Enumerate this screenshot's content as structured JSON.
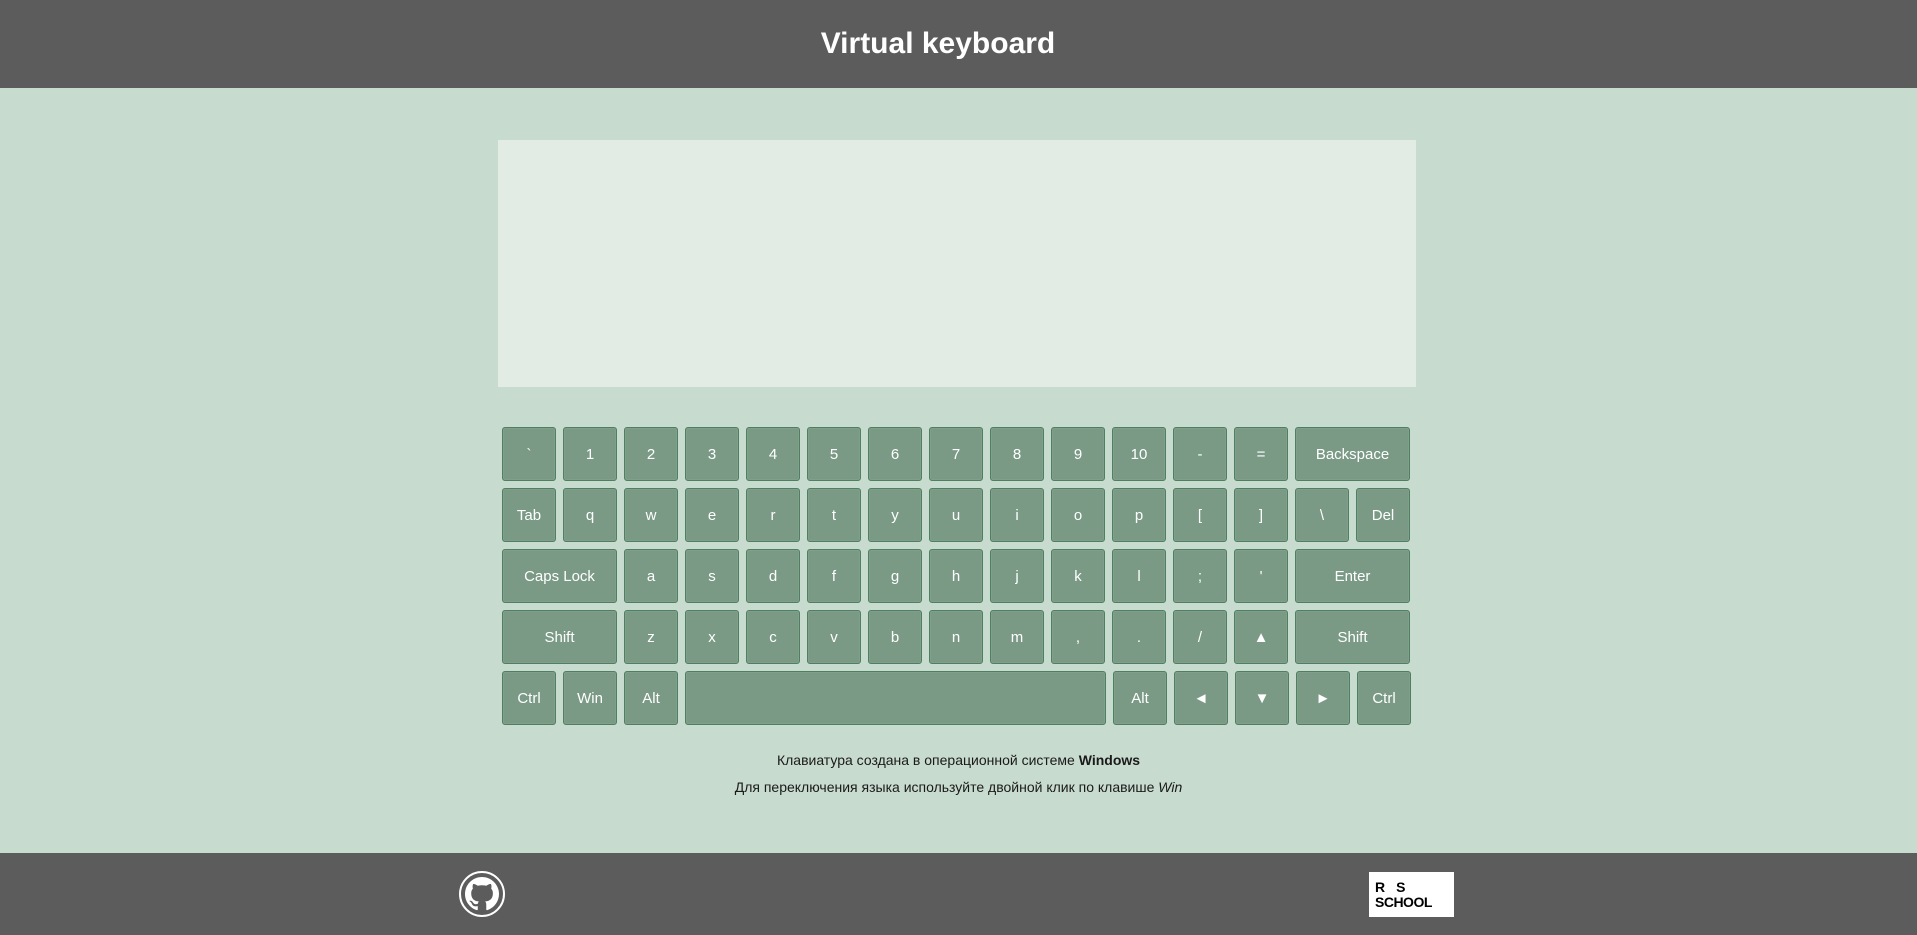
{
  "header": {
    "title": "Virtual keyboard"
  },
  "textarea": {
    "value": ""
  },
  "keyboard": {
    "rows": [
      [
        {
          "label": "`",
          "name": "key-backquote"
        },
        {
          "label": "1",
          "name": "key-1"
        },
        {
          "label": "2",
          "name": "key-2"
        },
        {
          "label": "3",
          "name": "key-3"
        },
        {
          "label": "4",
          "name": "key-4"
        },
        {
          "label": "5",
          "name": "key-5"
        },
        {
          "label": "6",
          "name": "key-6"
        },
        {
          "label": "7",
          "name": "key-7"
        },
        {
          "label": "8",
          "name": "key-8"
        },
        {
          "label": "9",
          "name": "key-9"
        },
        {
          "label": "10",
          "name": "key-10"
        },
        {
          "label": "-",
          "name": "key-minus"
        },
        {
          "label": "=",
          "name": "key-equal"
        },
        {
          "label": "Backspace",
          "name": "key-backspace",
          "wide": true
        }
      ],
      [
        {
          "label": "Tab",
          "name": "key-tab"
        },
        {
          "label": "q",
          "name": "key-q"
        },
        {
          "label": "w",
          "name": "key-w"
        },
        {
          "label": "e",
          "name": "key-e"
        },
        {
          "label": "r",
          "name": "key-r"
        },
        {
          "label": "t",
          "name": "key-t"
        },
        {
          "label": "y",
          "name": "key-y"
        },
        {
          "label": "u",
          "name": "key-u"
        },
        {
          "label": "i",
          "name": "key-i"
        },
        {
          "label": "o",
          "name": "key-o"
        },
        {
          "label": "p",
          "name": "key-p"
        },
        {
          "label": "[",
          "name": "key-bracket-left"
        },
        {
          "label": "]",
          "name": "key-bracket-right"
        },
        {
          "label": "\\",
          "name": "key-backslash"
        },
        {
          "label": "Del",
          "name": "key-del"
        }
      ],
      [
        {
          "label": "Caps Lock",
          "name": "key-capslock",
          "wide": true
        },
        {
          "label": "a",
          "name": "key-a"
        },
        {
          "label": "s",
          "name": "key-s"
        },
        {
          "label": "d",
          "name": "key-d"
        },
        {
          "label": "f",
          "name": "key-f"
        },
        {
          "label": "g",
          "name": "key-g"
        },
        {
          "label": "h",
          "name": "key-h"
        },
        {
          "label": "j",
          "name": "key-j"
        },
        {
          "label": "k",
          "name": "key-k"
        },
        {
          "label": "l",
          "name": "key-l"
        },
        {
          "label": ";",
          "name": "key-semicolon"
        },
        {
          "label": "'",
          "name": "key-quote"
        },
        {
          "label": "Enter",
          "name": "key-enter",
          "wide": true
        }
      ],
      [
        {
          "label": "Shift",
          "name": "key-shift-left",
          "wide": true
        },
        {
          "label": "z",
          "name": "key-z"
        },
        {
          "label": "x",
          "name": "key-x"
        },
        {
          "label": "c",
          "name": "key-c"
        },
        {
          "label": "v",
          "name": "key-v"
        },
        {
          "label": "b",
          "name": "key-b"
        },
        {
          "label": "n",
          "name": "key-n"
        },
        {
          "label": "m",
          "name": "key-m"
        },
        {
          "label": ",",
          "name": "key-comma"
        },
        {
          "label": ".",
          "name": "key-period"
        },
        {
          "label": "/",
          "name": "key-slash"
        },
        {
          "label": "▲",
          "name": "key-arrow-up"
        },
        {
          "label": "Shift",
          "name": "key-shift-right",
          "wide": true
        }
      ],
      [
        {
          "label": "Ctrl",
          "name": "key-ctrl-left"
        },
        {
          "label": "Win",
          "name": "key-win"
        },
        {
          "label": "Alt",
          "name": "key-alt-left"
        },
        {
          "label": "",
          "name": "key-space",
          "space": true
        },
        {
          "label": "Alt",
          "name": "key-alt-right"
        },
        {
          "label": "◄",
          "name": "key-arrow-left"
        },
        {
          "label": "▼",
          "name": "key-arrow-down"
        },
        {
          "label": "►",
          "name": "key-arrow-right"
        },
        {
          "label": "Ctrl",
          "name": "key-ctrl-right"
        }
      ]
    ]
  },
  "info": {
    "line1_text": "Клавиатура создана в операционной системе ",
    "line1_strong": "Windows",
    "line2_text": "Для переключения языка используйте двойной клик по клавише ",
    "line2_em": "Win"
  },
  "footer": {
    "github_icon": "github-icon",
    "rs_logo_line1": "RS",
    "rs_logo_line2": "SCHOOL"
  }
}
